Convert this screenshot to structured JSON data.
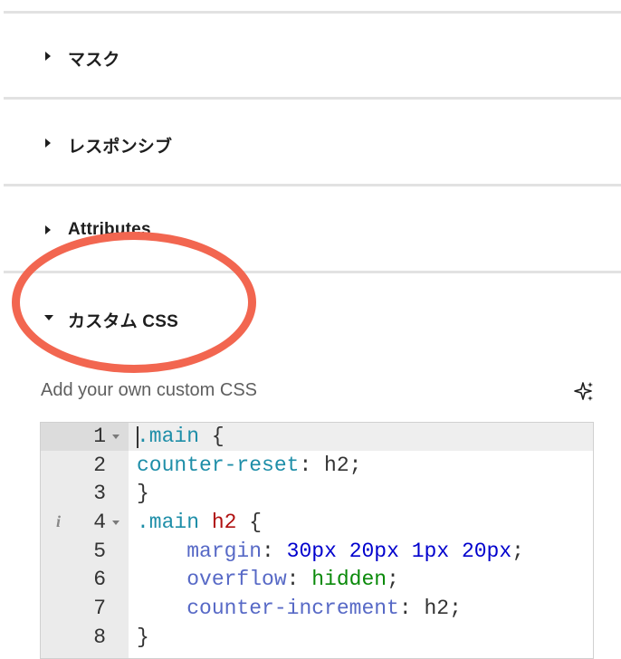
{
  "panel": {
    "sections": [
      {
        "label": "マスク",
        "expanded": false
      },
      {
        "label": "レスポンシブ",
        "expanded": false
      },
      {
        "label": "Attributes",
        "expanded": false
      },
      {
        "label": "カスタム CSS",
        "expanded": true
      }
    ],
    "custom_css": {
      "help_text": "Add your own custom CSS",
      "ai_icon": "sparkles-icon",
      "info_icon": "info-icon",
      "lines": [
        {
          "number": "1",
          "code": ".main {"
        },
        {
          "number": "2",
          "code": "counter-reset: h2;"
        },
        {
          "number": "3",
          "code": "}"
        },
        {
          "number": "4",
          "code": ".main h2 {"
        },
        {
          "number": "5",
          "code": "    margin: 30px 20px 1px 20px;"
        },
        {
          "number": "6",
          "code": "    overflow: hidden;"
        },
        {
          "number": "7",
          "code": "    counter-increment: h2;"
        },
        {
          "number": "8",
          "code": "}"
        }
      ]
    }
  },
  "annotation": {
    "color": "#f26650"
  }
}
